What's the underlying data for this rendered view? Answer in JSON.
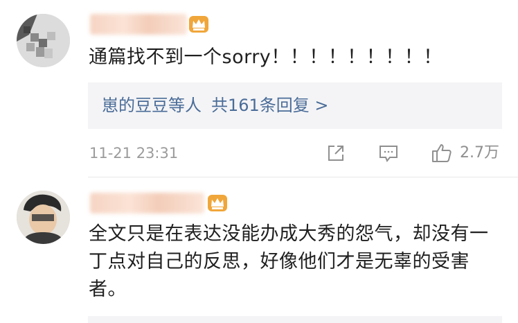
{
  "comments": [
    {
      "text": "通篇找不到一个sorry！！！！！！！！！",
      "reply_summary": {
        "users": "崽的豆豆等人",
        "total": "共161条回复 >"
      },
      "timestamp": "11-21 23:31",
      "likes": "2.7万",
      "icons": [
        "share-icon",
        "comment-icon",
        "like-icon"
      ]
    },
    {
      "text": "全文只是在表达没能办成大秀的怨气，却没有一丁点对自己的反思，好像他们才是无辜的受害者。"
    }
  ],
  "colors": {
    "link": "#4a6c98",
    "reply_bg": "#f4f4f6",
    "crown": "#f0a63a",
    "meta_text": "#9b9b9b"
  }
}
